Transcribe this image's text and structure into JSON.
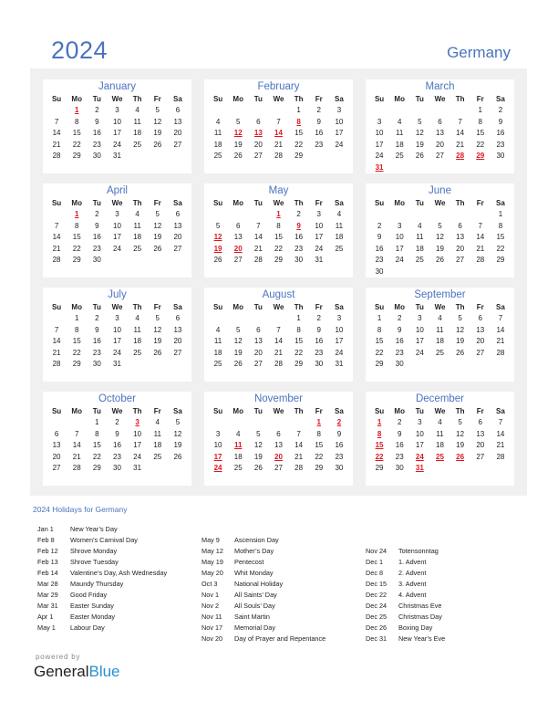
{
  "header": {
    "year": "2024",
    "country": "Germany"
  },
  "weekdays": [
    "Su",
    "Mo",
    "Tu",
    "We",
    "Th",
    "Fr",
    "Sa"
  ],
  "months": [
    {
      "name": "January",
      "start": 1,
      "days": 31,
      "holidays": [
        1
      ]
    },
    {
      "name": "February",
      "start": 4,
      "days": 29,
      "holidays": [
        8,
        12,
        13,
        14
      ]
    },
    {
      "name": "March",
      "start": 5,
      "days": 31,
      "holidays": [
        28,
        29,
        31
      ]
    },
    {
      "name": "April",
      "start": 1,
      "days": 30,
      "holidays": [
        1
      ]
    },
    {
      "name": "May",
      "start": 3,
      "days": 31,
      "holidays": [
        1,
        9,
        12,
        19,
        20
      ]
    },
    {
      "name": "June",
      "start": 6,
      "days": 30,
      "holidays": []
    },
    {
      "name": "July",
      "start": 1,
      "days": 31,
      "holidays": []
    },
    {
      "name": "August",
      "start": 4,
      "days": 31,
      "holidays": []
    },
    {
      "name": "September",
      "start": 0,
      "days": 30,
      "holidays": []
    },
    {
      "name": "October",
      "start": 2,
      "days": 31,
      "holidays": [
        3
      ]
    },
    {
      "name": "November",
      "start": 5,
      "days": 30,
      "holidays": [
        1,
        2,
        11,
        17,
        20,
        24
      ]
    },
    {
      "name": "December",
      "start": 0,
      "days": 31,
      "holidays": [
        1,
        8,
        15,
        22,
        24,
        25,
        26,
        31
      ]
    }
  ],
  "holidays_title": "2024 Holidays for Germany",
  "holiday_columns": [
    [
      {
        "date": "Jan 1",
        "name": "New Year’s Day"
      },
      {
        "date": "Feb 8",
        "name": "Women’s Carnival Day"
      },
      {
        "date": "Feb 12",
        "name": "Shrove Monday"
      },
      {
        "date": "Feb 13",
        "name": "Shrove Tuesday"
      },
      {
        "date": "Feb 14",
        "name": "Valentine’s Day, Ash Wednesday"
      },
      {
        "date": "Mar 28",
        "name": "Maundy Thursday"
      },
      {
        "date": "Mar 29",
        "name": "Good Friday"
      },
      {
        "date": "Mar 31",
        "name": "Easter Sunday"
      },
      {
        "date": "Apr 1",
        "name": "Easter Monday"
      },
      {
        "date": "May 1",
        "name": "Labour Day"
      }
    ],
    [
      {
        "date": "May 9",
        "name": "Ascension Day"
      },
      {
        "date": "May 12",
        "name": "Mother’s Day"
      },
      {
        "date": "May 19",
        "name": "Pentecost"
      },
      {
        "date": "May 20",
        "name": "Whit Monday"
      },
      {
        "date": "Oct 3",
        "name": "National Holiday"
      },
      {
        "date": "Nov 1",
        "name": "All Saints’ Day"
      },
      {
        "date": "Nov 2",
        "name": "All Souls’ Day"
      },
      {
        "date": "Nov 11",
        "name": "Saint Martin"
      },
      {
        "date": "Nov 17",
        "name": "Memorial Day"
      },
      {
        "date": "Nov 20",
        "name": "Day of Prayer and Repentance"
      }
    ],
    [
      {
        "date": "Nov 24",
        "name": "Totensonntag"
      },
      {
        "date": "Dec 1",
        "name": "1. Advent"
      },
      {
        "date": "Dec 8",
        "name": "2. Advent"
      },
      {
        "date": "Dec 15",
        "name": "3. Advent"
      },
      {
        "date": "Dec 22",
        "name": "4. Advent"
      },
      {
        "date": "Dec 24",
        "name": "Christmas Eve"
      },
      {
        "date": "Dec 25",
        "name": "Christmas Day"
      },
      {
        "date": "Dec 26",
        "name": "Boxing Day"
      },
      {
        "date": "Dec 31",
        "name": "New Year’s Eve"
      }
    ]
  ],
  "footer": {
    "powered_by": "powered by",
    "brand_general": "General",
    "brand_blue": "Blue"
  },
  "colors": {
    "accent": "#4a74bf",
    "holiday": "#e0141e",
    "panel_bg": "#f0f0f0",
    "brand_blue": "#2a8fd0"
  }
}
